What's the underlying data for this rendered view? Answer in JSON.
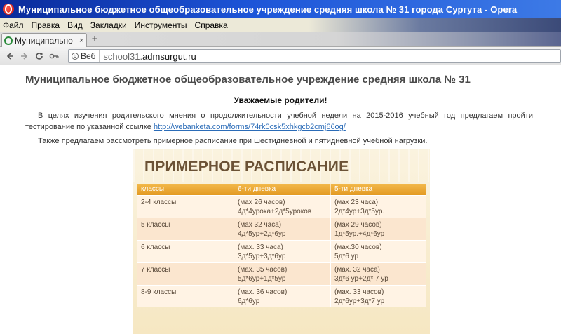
{
  "window": {
    "title": "Муниципальное бюджетное общеобразовательное учреждение средняя школа № 31 города Сургута - Opera"
  },
  "menu": [
    "Файл",
    "Правка",
    "Вид",
    "Закладки",
    "Инструменты",
    "Справка"
  ],
  "tab": {
    "label": "Муниципально",
    "close": "×",
    "new_tab": "+"
  },
  "address": {
    "web_label": "Веб",
    "url_prefix": "school31.",
    "url_domain": "admsurgut.ru"
  },
  "page": {
    "heading": "Муниципальное бюджетное общеобразовательное учреждение средняя школа № 31",
    "subheading": "Уважаемые родители!",
    "para1_text": "В  целях изучения родительского мнения о продолжительности учебной недели  на 2015-2016 учебный год предлагаем пройти тестирование по указанной ссылке ",
    "para1_link": "http://webanketa.com/forms/74rk0csk5xhkgcb2cmj66og/",
    "para2": "Также предлагаем рассмотреть примерное расписание при шестидневной и пятидневной учебной нагрузки."
  },
  "schedule": {
    "title": "ПРИМЕРНОЕ РАСПИСАНИЕ",
    "headers": [
      "классы",
      "6-ти дневка",
      "5-ти дневка"
    ],
    "rows": [
      {
        "cls": "2-4 классы",
        "six_1": "(мах 26 часов)",
        "six_2": "4д*4урока+2д*5уроков",
        "five_1": "(мах 23 часа)",
        "five_2": "2д*4ур+3д*5ур."
      },
      {
        "cls": "5 классы",
        "six_1": "(мах 32 часа)",
        "six_2": "4д*5ур+2д*6ур",
        "five_1": "(мах 29 часов)",
        "five_2": "1д*5ур.+4д*6ур"
      },
      {
        "cls": "6 классы",
        "six_1": "(мах. 33 часа)",
        "six_2": "3д*5ур+3д*6ур",
        "five_1": "(мах.30 часов)",
        "five_2": "5д*6 ур"
      },
      {
        "cls": "7 классы",
        "six_1": "(мах. 35 часов)",
        "six_2": "5д*6ур+1д*5ур",
        "five_1": "(мах. 32 часа)",
        "five_2": "3д*6 ур+2д* 7 ур"
      },
      {
        "cls": "8-9 классы",
        "six_1": "(мах. 36 часов)",
        "six_2": "6д*6ур",
        "five_1": "(мах. 33 часов)",
        "five_2": "2д*6ур+3д*7 ур"
      }
    ]
  }
}
